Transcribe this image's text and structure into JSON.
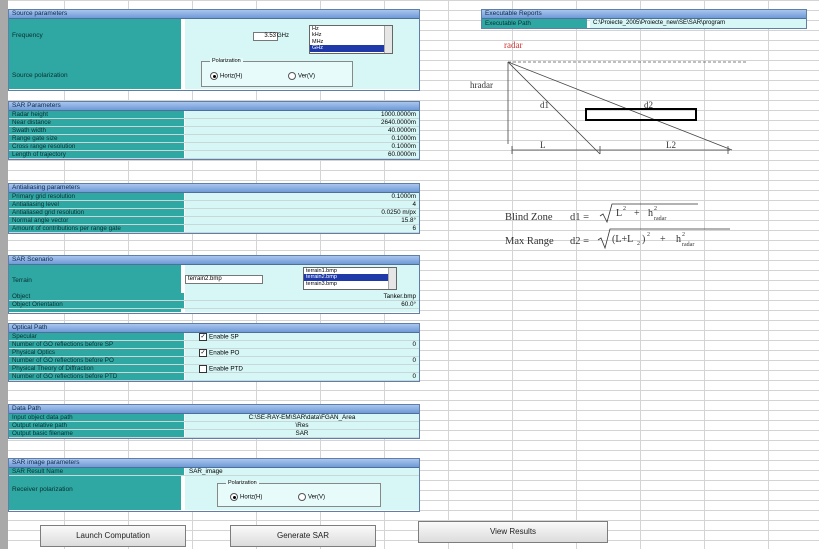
{
  "source": {
    "header": "Source parameters",
    "frequency_label": "Frequency",
    "frequency_value": "3.53",
    "frequency_unit": "GHz",
    "unit_options": [
      "Hz",
      "kHz",
      "MHz",
      "GHz"
    ],
    "unit_selected": "GHz",
    "polarization_label": "Source polarization",
    "polarization_legend": "Polarization",
    "pol_options": [
      "Horiz(H)",
      "Ver(V)"
    ],
    "pol_selected": "Horiz(H)"
  },
  "sar": {
    "header": "SAR Parameters",
    "rows": [
      {
        "label": "Radar height",
        "value": "1000.0000m"
      },
      {
        "label": "Near distance",
        "value": "2640.0000m"
      },
      {
        "label": "Swath width",
        "value": "40.0000m"
      },
      {
        "label": "Range gate size",
        "value": "0.1000m"
      },
      {
        "label": "Cross range resolution",
        "value": "0.1000m"
      },
      {
        "label": "Length of trajectory",
        "value": "60.0000m"
      }
    ]
  },
  "antialias": {
    "header": "Antialiasing parameters",
    "rows": [
      {
        "label": "Primary grid resolution",
        "value": "0.1000m"
      },
      {
        "label": "Antialiasing level",
        "value": "4"
      },
      {
        "label": "Antialiased grid resolution",
        "value": "0.0250 m/px"
      },
      {
        "label": "Normal angle vector",
        "value": "15.8°"
      },
      {
        "label": "Amount of contributions per range gate",
        "value": "6"
      }
    ]
  },
  "scenario": {
    "header": "SAR Scenario",
    "terrain_label": "Terrain",
    "terrain_value": "terrain2.bmp",
    "terrain_options": [
      "terrain1.bmp",
      "terrain2.bmp",
      "terrain3.bmp"
    ],
    "terrain_selected": "terrain2.bmp",
    "object_label": "Object",
    "object_value": "Tanker.bmp",
    "orientation_label": "Object Orientation",
    "orientation_value": "60.0°"
  },
  "optical": {
    "header": "Optical Path",
    "rows": [
      {
        "label": "Specular",
        "value": "Enable SP",
        "checked": true
      },
      {
        "label": "Number of GO reflections before SP",
        "value": "0"
      },
      {
        "label": "Physical Optics",
        "value": "Enable PO",
        "checked": true
      },
      {
        "label": "Number of GO reflections before PO",
        "value": "0"
      },
      {
        "label": "Physical Theory of Diffraction",
        "value": "Enable PTD",
        "checked": false
      },
      {
        "label": "Number of GO reflections before PTD",
        "value": "0"
      }
    ]
  },
  "datapath": {
    "header": "Data Path",
    "rows": [
      {
        "label": "Input object data path",
        "value": "C:\\SE-RAY-EM\\SAR\\data\\FGAN_Area"
      },
      {
        "label": "Output relative path",
        "value": "\\Res"
      },
      {
        "label": "Output basic filename",
        "value": "SAR"
      }
    ]
  },
  "image": {
    "header": "SAR image parameters",
    "result_label": "SAR Result Name",
    "result_value": "SAR_image",
    "polarization_label": "Receiver polarization",
    "polarization_legend": "Polarization",
    "pol_options": [
      "Horiz(H)",
      "Ver(V)"
    ],
    "pol_selected": "Horiz(H)"
  },
  "report": {
    "header": "Executable Reports",
    "path_label": "Executable Path",
    "path_value": "C:\\Proiecte_2005\\Proiecte_new\\SE\\SAR\\program"
  },
  "diagram": {
    "radar": "radar",
    "hradar": "hradar",
    "d1": "d1",
    "d2": "d2",
    "L": "L",
    "L2": "L2"
  },
  "formulas": {
    "blind_label": "Blind Zone",
    "blind_lhs": "d1 =",
    "range_label": "Max Range",
    "range_lhs": "d2 ="
  },
  "buttons": {
    "launch": "Launch Computation",
    "generate": "Generate SAR",
    "view": "View Results"
  }
}
